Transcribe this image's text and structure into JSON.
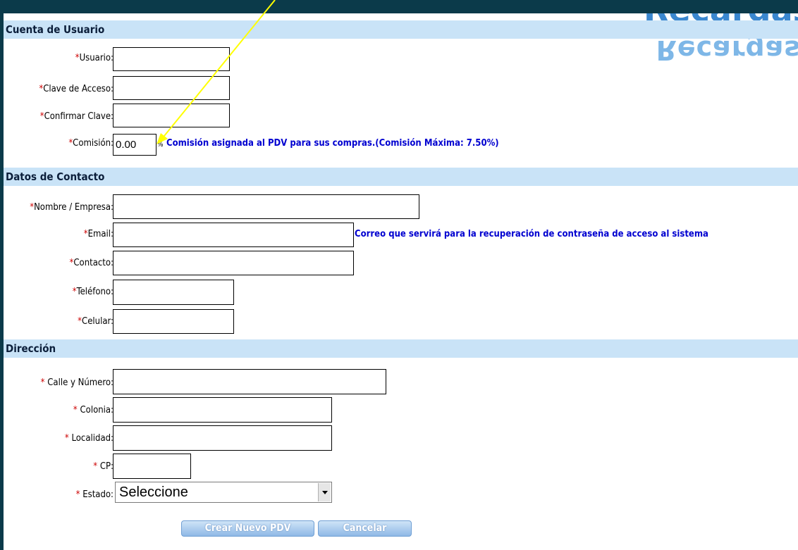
{
  "logo": {
    "text": "Recargas"
  },
  "sections": {
    "account": "Cuenta de Usuario",
    "contact": "Datos de Contacto",
    "address": "Dirección"
  },
  "fields": {
    "usuario": {
      "label": "Usuario:",
      "value": ""
    },
    "clave": {
      "label": "Clave de Acceso:",
      "value": ""
    },
    "confirmar": {
      "label": "Confirmar Clave:",
      "value": ""
    },
    "comision": {
      "label": "Comisión:",
      "value": "0.00",
      "unit": "%",
      "note": "Comisión asignada al PDV para sus compras.(Comisión Máxima: 7.50%)"
    },
    "nombre": {
      "label": "Nombre / Empresa:",
      "value": ""
    },
    "email": {
      "label": "Email:",
      "value": "",
      "note": "Correo que servirá para la recuperación de contraseña de acceso al sistema"
    },
    "contacto": {
      "label": "Contacto:",
      "value": ""
    },
    "telefono": {
      "label": "Teléfono:",
      "value": ""
    },
    "celular": {
      "label": "Celular:",
      "value": ""
    },
    "calle": {
      "label": " Calle y Número:",
      "value": ""
    },
    "colonia": {
      "label": " Colonia:",
      "value": ""
    },
    "localidad": {
      "label": " Localidad:",
      "value": ""
    },
    "cp": {
      "label": " CP:",
      "value": ""
    },
    "estado": {
      "label": " Estado:",
      "selected": "Seleccione"
    }
  },
  "required_mark": "*",
  "buttons": {
    "create": "Crear Nuevo PDV",
    "cancel": "Cancelar"
  },
  "colors": {
    "section_bg": "#c9e3f7",
    "note": "#0000d0",
    "required": "#cc0000",
    "frame": "#0b3a4a",
    "annotation_arrow": "#ffff00"
  }
}
